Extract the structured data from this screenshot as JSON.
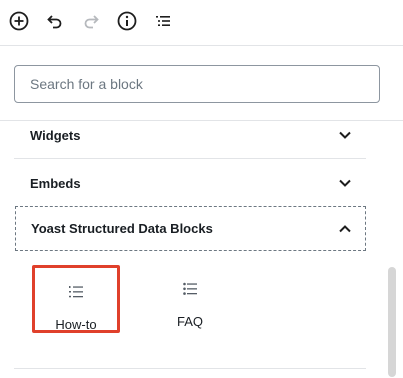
{
  "toolbar": {
    "buttons": [
      {
        "name": "add-block",
        "icon": "plus-circle-icon"
      },
      {
        "name": "undo",
        "icon": "undo-icon"
      },
      {
        "name": "redo",
        "icon": "redo-icon"
      },
      {
        "name": "info",
        "icon": "info-icon"
      },
      {
        "name": "outline",
        "icon": "list-view-icon"
      }
    ]
  },
  "search": {
    "placeholder": "Search for a block",
    "value": ""
  },
  "categories": [
    {
      "label": "Widgets",
      "expanded": false,
      "icon": "chevron-down-icon"
    },
    {
      "label": "Embeds",
      "expanded": false,
      "icon": "chevron-down-icon"
    },
    {
      "label": "Yoast Structured Data Blocks",
      "expanded": true,
      "icon": "chevron-up-icon"
    }
  ],
  "blocks": [
    {
      "label": "How-to",
      "icon": "ordered-list-icon",
      "highlighted": true
    },
    {
      "label": "FAQ",
      "icon": "unordered-list-icon",
      "highlighted": false
    }
  ],
  "colors": {
    "highlight": "#e0402b",
    "text": "#191e23",
    "border": "#8d96a0",
    "divider": "#e2e4e7"
  }
}
